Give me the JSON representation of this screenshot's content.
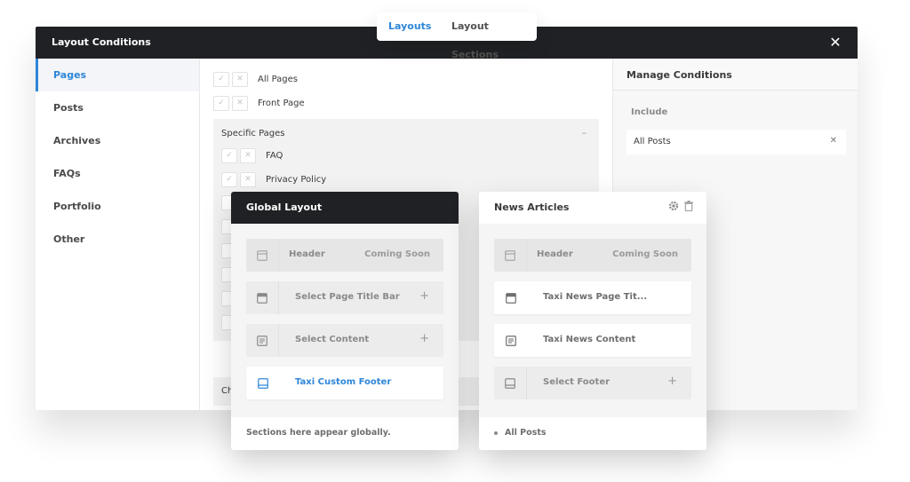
{
  "top_tabs": {
    "layouts": "Layouts",
    "layout_sections": "Layout Sections"
  },
  "dialog": {
    "title": "Layout Conditions",
    "sidebar": [
      "Pages",
      "Posts",
      "Archives",
      "FAQs",
      "Portfolio",
      "Other"
    ],
    "conditions": {
      "top": [
        "All Pages",
        "Front Page"
      ],
      "specific_title": "Specific Pages",
      "specific_items": [
        "FAQ",
        "Privacy Policy"
      ],
      "partial_label": "Ch"
    },
    "manage": {
      "title": "Manage Conditions",
      "include_label": "Include",
      "include_item": "All Posts"
    }
  },
  "global_layout": {
    "title": "Global Layout",
    "header_label": "Header",
    "header_status": "Coming Soon",
    "page_title_bar": "Select Page Title Bar",
    "content": "Select Content",
    "footer": "Taxi Custom Footer",
    "footnote": "Sections here appear globally."
  },
  "news_articles": {
    "title": "News Articles",
    "header_label": "Header",
    "header_status": "Coming Soon",
    "page_title_bar": "Taxi News Page Tit...",
    "content": "Taxi News Content",
    "footer": "Select Footer",
    "footnote": "All Posts"
  },
  "icons": {
    "close": "close-icon",
    "check": "check-icon",
    "exclude": "x-icon",
    "gear": "gear-icon",
    "trash": "trash-icon",
    "plus": "plus-icon"
  },
  "colors": {
    "accent": "#2f86d8",
    "dark": "#1f2124"
  }
}
